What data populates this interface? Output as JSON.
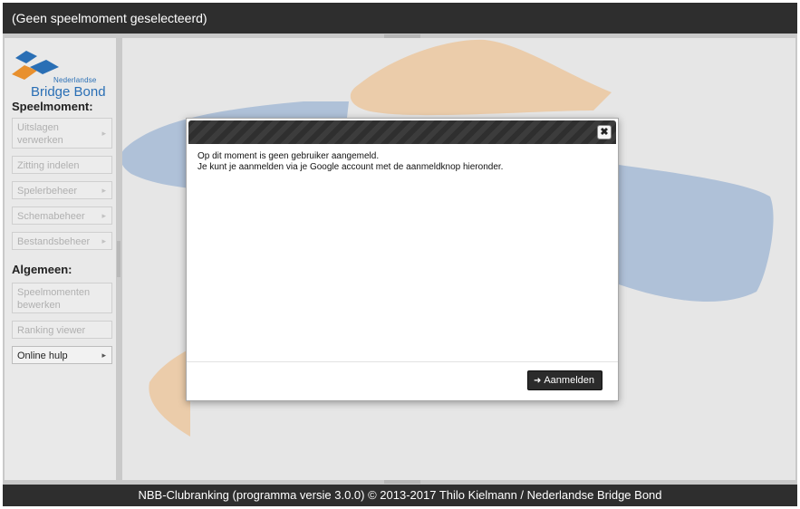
{
  "header": {
    "title": "(Geen speelmoment geselecteerd)"
  },
  "logo": {
    "line1": "Nederlandse",
    "line2": "Bridge Bond"
  },
  "sidebar": {
    "section1": "Speelmoment:",
    "items1": [
      {
        "label": "Uitslagen verwerken",
        "state": "disabled"
      },
      {
        "label": "Zitting indelen",
        "state": "disabled"
      },
      {
        "label": "Spelerbeheer",
        "state": "disabled"
      },
      {
        "label": "Schemabeheer",
        "state": "disabled"
      },
      {
        "label": "Bestandsbeheer",
        "state": "disabled"
      }
    ],
    "section2": "Algemeen:",
    "items2": [
      {
        "label": "Speelmomenten bewerken",
        "state": "disabled"
      },
      {
        "label": "Ranking viewer",
        "state": "disabled"
      },
      {
        "label": "Online hulp",
        "state": "enabled"
      }
    ]
  },
  "dialog": {
    "close_icon": "close-icon",
    "line1": "Op dit moment is geen gebruiker aangemeld.",
    "line2": "Je kunt je aanmelden via je Google account met de aanmeldknop hieronder.",
    "login_label": "Aanmelden",
    "login_icon": "login-icon"
  },
  "footer": {
    "text": "NBB-Clubranking (programma versie 3.0.0) © 2013-2017 Thilo Kielmann / Nederlandse Bridge Bond"
  },
  "colors": {
    "bar": "#2e2e2e",
    "logo_blue": "#2a6fb5",
    "logo_orange": "#e8902e",
    "watermark_blue": "#a9bdd6",
    "watermark_orange": "#ebc9a3"
  }
}
